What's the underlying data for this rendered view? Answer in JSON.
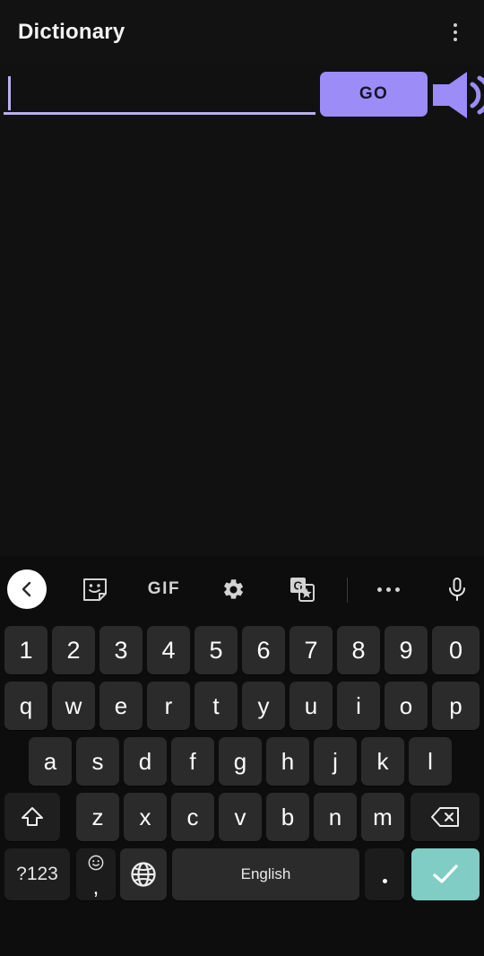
{
  "app": {
    "title": "Dictionary",
    "overflow_icon": "more-vert-icon"
  },
  "search": {
    "input_value": "",
    "placeholder": "",
    "go_label": "GO",
    "speaker_icon": "speaker-volume-icon",
    "accent_color": "#9b8cf7",
    "underline_color": "#b9b0f0"
  },
  "results": {
    "content": ""
  },
  "keyboard": {
    "toolbar": [
      {
        "name": "back-button",
        "icon": "chevron-left-icon",
        "label": ""
      },
      {
        "name": "sticker-button",
        "icon": "sticker-icon",
        "label": ""
      },
      {
        "name": "gif-button",
        "icon": "gif-icon",
        "label": "GIF"
      },
      {
        "name": "settings-button",
        "icon": "gear-icon",
        "label": ""
      },
      {
        "name": "translate-button",
        "icon": "google-translate-icon",
        "label": ""
      },
      {
        "name": "more-options-button",
        "icon": "more-horizontal-icon",
        "label": ""
      },
      {
        "name": "voice-input-button",
        "icon": "microphone-icon",
        "label": ""
      }
    ],
    "row_numbers": [
      "1",
      "2",
      "3",
      "4",
      "5",
      "6",
      "7",
      "8",
      "9",
      "0"
    ],
    "row_top": [
      "q",
      "w",
      "e",
      "r",
      "t",
      "y",
      "u",
      "i",
      "o",
      "p"
    ],
    "row_home": [
      "a",
      "s",
      "d",
      "f",
      "g",
      "h",
      "j",
      "k",
      "l"
    ],
    "row_bottom": [
      "z",
      "x",
      "c",
      "v",
      "b",
      "n",
      "m"
    ],
    "shift_icon": "shift-arrow-icon",
    "backspace_icon": "backspace-icon",
    "symbols_label": "?123",
    "emoji_icon": "emoji-smiley-icon",
    "comma_label": ",",
    "globe_icon": "globe-language-icon",
    "space_label": "English",
    "period_label": ".",
    "enter_icon": "checkmark-icon",
    "enter_color": "#7fcdc4",
    "key_color": "#2b2b2b",
    "background_color": "#0d0d0d"
  }
}
